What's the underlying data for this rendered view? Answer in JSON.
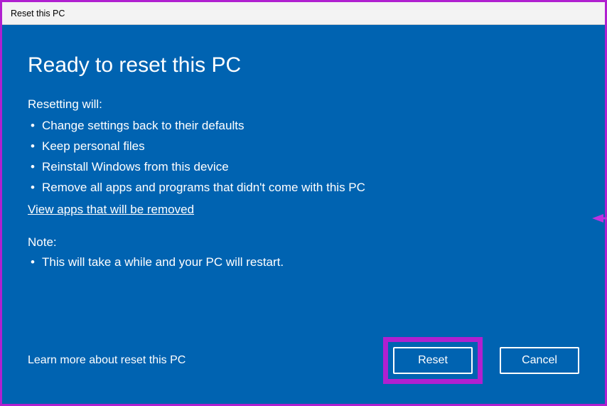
{
  "window": {
    "title": "Reset this PC"
  },
  "main": {
    "heading": "Ready to reset this PC",
    "resetting_label": "Resetting will:",
    "bullets": [
      "Change settings back to their defaults",
      "Keep personal files",
      "Reinstall Windows from this device",
      "Remove all apps and programs that didn't come with this PC"
    ],
    "view_apps_link": "View apps that will be removed",
    "note_label": "Note:",
    "note_bullets": [
      "This will take a while and your PC will restart."
    ]
  },
  "footer": {
    "learn_more": "Learn more about reset this PC",
    "reset_label": "Reset",
    "cancel_label": "Cancel"
  },
  "colors": {
    "background": "#0063b1",
    "highlight": "#b020d0",
    "arrow": "#b020d0"
  }
}
